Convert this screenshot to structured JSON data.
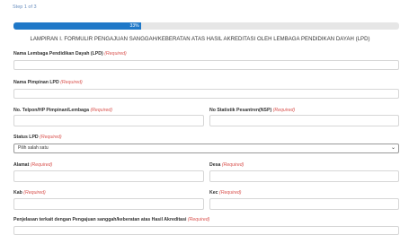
{
  "step_text": "Step 1 of 3",
  "progress": {
    "percent": 33,
    "label": "33%"
  },
  "heading": "LAMPIRAN I. FORMULIR PENGAJUAN SANGGAH/KEBERATAN ATAS HASIL AKREDITASI OLEH LEMBAGA PENDIDIKAN DAYAH (LPD)",
  "required_text": "(Required)",
  "fields": {
    "nama_lembaga": "Nama Lembaga Pendidikan Dayah (LPD)",
    "nama_pimpinan": "Nama Pimpinan LPD",
    "telpon": "No. Telpon/HP Pimpinan/Lembaga",
    "nsp": "No Statistik Pesantren(NSP)",
    "status": "Status LPD",
    "alamat": "Alamat",
    "desa": "Desa",
    "kab": "Kab",
    "kec": "Kec",
    "penjelasan": "Penjelasan terkait dengan Pengajuan sanggah/keberatan atas Hasil Akreditasi"
  },
  "status_select": {
    "selected": "Pilih salah satu"
  },
  "colors": {
    "accent": "#1f78c8",
    "required": "#d9534f",
    "step": "#6a8fbf"
  },
  "icons": {
    "select_arrow": "chevron-down-icon"
  }
}
